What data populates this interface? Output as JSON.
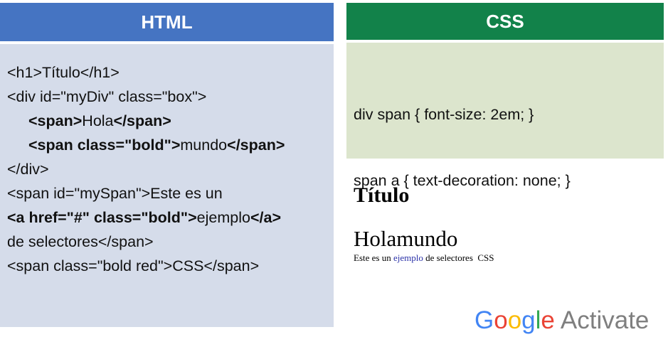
{
  "html_panel": {
    "title": "HTML",
    "lines": [
      {
        "parts": [
          {
            "text": "<h1>Título</h1>",
            "bold": false
          }
        ]
      },
      {
        "parts": [
          {
            "text": "<div id=\"myDiv\" class=\"box\">",
            "bold": false
          }
        ]
      },
      {
        "parts": [
          {
            "text": "<span>",
            "bold": true
          },
          {
            "text": "Hola",
            "bold": false
          },
          {
            "text": "</span>",
            "bold": true
          }
        ]
      },
      {
        "parts": [
          {
            "text": "<span class=\"bold\">",
            "bold": true
          },
          {
            "text": "mundo",
            "bold": false
          },
          {
            "text": "</span>",
            "bold": true
          }
        ]
      },
      {
        "parts": [
          {
            "text": "</div>",
            "bold": false
          }
        ]
      },
      {
        "parts": [
          {
            "text": "<span id=\"mySpan\">Este es un",
            "bold": false
          }
        ]
      },
      {
        "parts": [
          {
            "text": "<a href=\"#\" class=\"bold\">",
            "bold": true
          },
          {
            "text": "ejemplo",
            "bold": false
          },
          {
            "text": "</a>",
            "bold": true
          }
        ]
      },
      {
        "parts": [
          {
            "text": "de selectores</span>",
            "bold": false
          }
        ]
      },
      {
        "parts": [
          {
            "text": "<span class=\"bold red\">CSS</span>",
            "bold": false
          }
        ]
      }
    ]
  },
  "css_panel": {
    "title": "CSS",
    "lines": [
      "div span { font-size: 2em; }",
      "span a { text-decoration: none; }"
    ]
  },
  "render": {
    "title": "Título",
    "hola": "Hola",
    "mundo": "mundo",
    "line_prefix": "Este es un ",
    "link_text": "ejemplo",
    "line_mid": " de selectores  ",
    "line_suffix": "CSS",
    "link_color": "#2a31a8"
  },
  "watermark": {
    "logo_letters": [
      "G",
      "o",
      "o",
      "g",
      "l",
      "e"
    ],
    "logo_colors": [
      "#4285f4",
      "#ea4335",
      "#fbbc05",
      "#4285f4",
      "#34a853",
      "#ea4335"
    ],
    "label": "Activate"
  },
  "colors": {
    "html_header": "#4574c2",
    "html_body": "#d5dcea",
    "css_header": "#12824a",
    "css_body": "#dce5cd"
  }
}
